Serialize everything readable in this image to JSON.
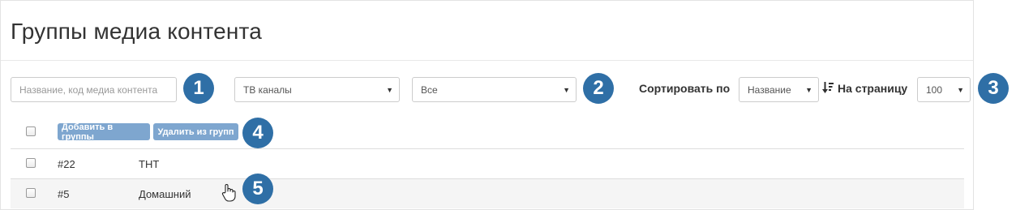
{
  "header": {
    "title": "Группы медиа контента"
  },
  "filters": {
    "search_placeholder": "Название, код медиа контента",
    "type_select": "ТВ каналы",
    "status_select": "Все",
    "sort_label": "Сортировать по",
    "sort_select": "Название",
    "per_page_label": "На страницу",
    "per_page_select": "100"
  },
  "actions": {
    "add_to_groups": "Добавить в группы",
    "remove_from_groups": "Удалить из групп"
  },
  "rows": [
    {
      "id": "#22",
      "name": "ТНТ"
    },
    {
      "id": "#5",
      "name": "Домашний"
    }
  ],
  "callouts": [
    "1",
    "2",
    "3",
    "4",
    "5"
  ],
  "colors": {
    "callout": "#2f6fa6",
    "action_button": "#7ea6cf"
  }
}
